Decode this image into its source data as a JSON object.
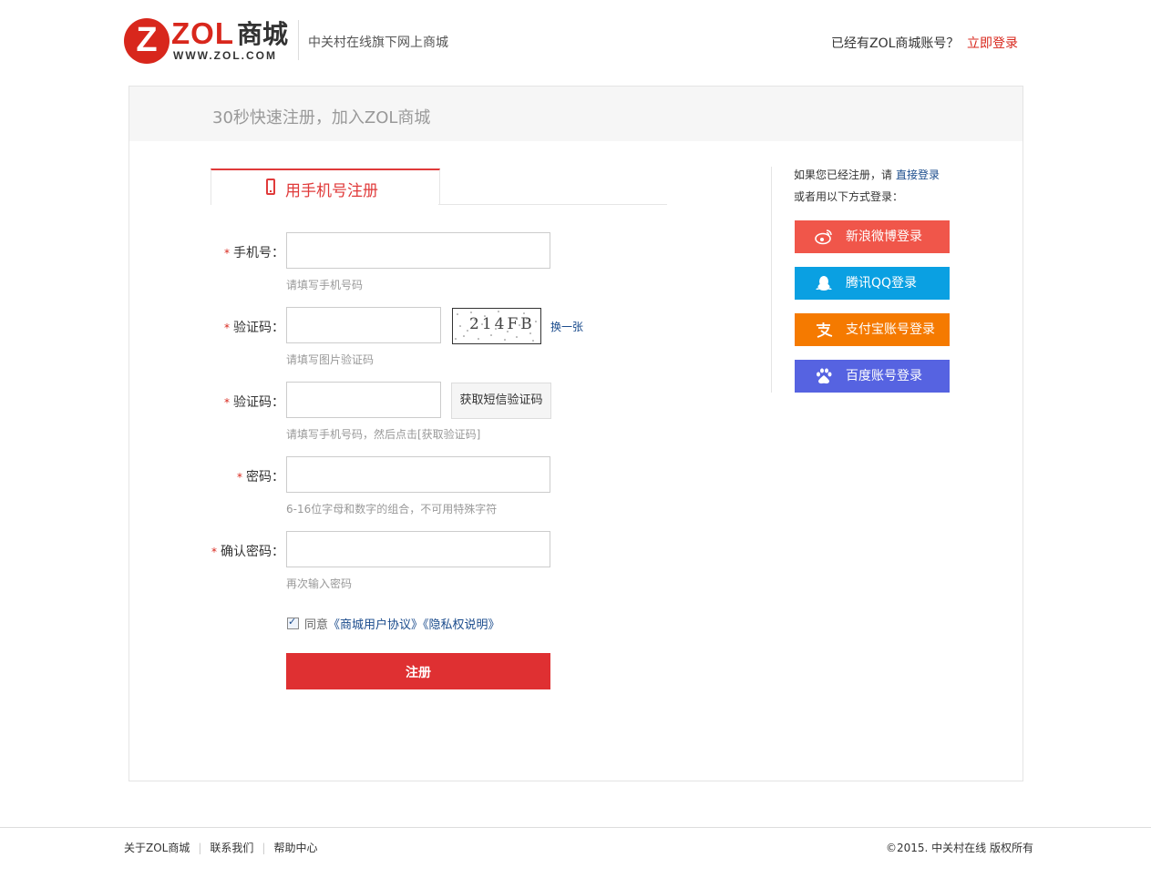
{
  "header": {
    "logo": {
      "badge_letter": "Z",
      "brand": "ZOL",
      "brand_cn": "商城",
      "url_text": "WWW.ZOL.COM"
    },
    "slogan": "中关村在线旗下网上商城",
    "have_account": "已经有ZOL商城账号？",
    "login_link": "立即登录"
  },
  "main": {
    "title": "30秒快速注册，加入ZOL商城",
    "tab_label": "用手机号注册",
    "form": {
      "required_mark": "*",
      "phone_label": "手机号：",
      "phone_value": "",
      "phone_hint": "请填写手机号码",
      "captcha_label": "验证码：",
      "captcha_value": "",
      "captcha_image_text": "214FB",
      "captcha_refresh": "换一张",
      "captcha_hint": "请填写图片验证码",
      "sms_label": "验证码：",
      "sms_value": "",
      "sms_button": "获取短信验证码",
      "sms_hint": "请填写手机号码，然后点击[获取验证码]",
      "password_label": "密码：",
      "password_value": "",
      "password_hint": "6-16位字母和数字的组合，不可用特殊字符",
      "confirm_label": "确认密码：",
      "confirm_value": "",
      "confirm_hint": "再次输入密码",
      "agree_checked": true,
      "agree_prefix": "同意",
      "agreement_link": "《商城用户协议》",
      "privacy_link": "《隐私权说明》",
      "submit": "注册"
    },
    "side": {
      "already_text": "如果您已经注册，请",
      "direct_login": "直接登录",
      "or_text": "或者用以下方式登录：",
      "socials": [
        {
          "label": "新浪微博登录",
          "icon": "weibo-icon",
          "color": "#f0564a"
        },
        {
          "label": "腾讯QQ登录",
          "icon": "qq-icon",
          "color": "#0aa0e2"
        },
        {
          "label": "支付宝账号登录",
          "icon": "alipay-icon",
          "color": "#f57a00"
        },
        {
          "label": "百度账号登录",
          "icon": "baidu-icon",
          "color": "#5663e1"
        }
      ]
    }
  },
  "footer": {
    "links": [
      "关于ZOL商城",
      "联系我们",
      "帮助中心"
    ],
    "separator": "|",
    "copyright": "©2015. 中关村在线 版权所有"
  },
  "colors": {
    "accent": "#d8271c",
    "button": "#df3032",
    "link": "#1a4b8c"
  }
}
